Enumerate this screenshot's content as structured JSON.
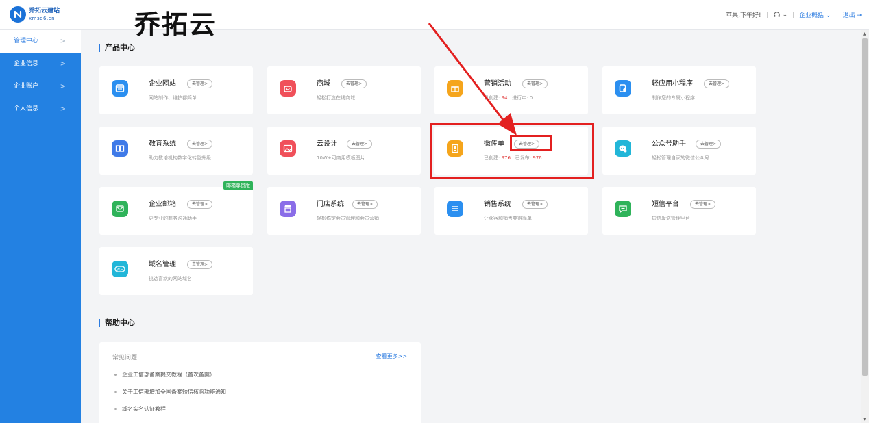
{
  "header": {
    "logo_name": "乔拓云建站",
    "logo_domain": "xmsq6.cn",
    "overlay_title": "乔拓云",
    "greeting": "苹果,下午好!",
    "enterprise_menu": "企业概括",
    "logout": "退出"
  },
  "sidebar": {
    "items": [
      {
        "label": "管理中心"
      },
      {
        "label": "企业信息"
      },
      {
        "label": "企业账户"
      },
      {
        "label": "个人信息"
      }
    ]
  },
  "product_center": {
    "title": "产品中心",
    "manage_label": "去管理>",
    "cards": [
      {
        "name": "企业网站",
        "desc": "网站制作、维护都简单",
        "icon": "website-icon",
        "color": "#2b8ff0"
      },
      {
        "name": "商城",
        "desc": "轻松打造在线商城",
        "icon": "shopping-bag-icon",
        "color": "#f0505a"
      },
      {
        "name": "营销活动",
        "desc_created_label": "已创建:",
        "desc_created_value": "94",
        "desc_active_label": "进行中:",
        "desc_active_value": "0",
        "icon": "gift-icon",
        "color": "#f5a51c"
      },
      {
        "name": "轻应用小程序",
        "desc": "制作您的专属小程序",
        "icon": "miniapp-icon",
        "color": "#2b8ff0"
      },
      {
        "name": "教育系统",
        "desc": "助力教培机构数字化转型升级",
        "icon": "book-icon",
        "color": "#3f7ae8"
      },
      {
        "name": "云设计",
        "desc": "10W+可商用模板图片",
        "icon": "image-icon",
        "color": "#f0505a"
      },
      {
        "name": "微传单",
        "desc_created_label": "已创建:",
        "desc_created_value": "976",
        "desc_published_label": "已发布:",
        "desc_published_value": "976",
        "icon": "flyer-icon",
        "color": "#f5a51c"
      },
      {
        "name": "公众号助手",
        "desc": "轻松管理自家的微信公众号",
        "icon": "wechat-icon",
        "color": "#22b6d8"
      },
      {
        "name": "企业邮箱",
        "desc": "更专业的商务沟通助手",
        "icon": "mail-icon",
        "color": "#2fb35a",
        "badge": "邮箱尊贵版"
      },
      {
        "name": "门店系统",
        "desc": "轻松搞定会员管理和会员营销",
        "icon": "store-icon",
        "color": "#8a6de8"
      },
      {
        "name": "销售系统",
        "desc": "让获客和销售变得简单",
        "icon": "list-icon",
        "color": "#2b8ff0"
      },
      {
        "name": "短信平台",
        "desc": "短信发送管理平台",
        "icon": "sms-icon",
        "color": "#2fb35a"
      },
      {
        "name": "域名管理",
        "desc": "挑选喜欢的网站域名",
        "icon": "domain-icon",
        "color": "#22b6d8"
      }
    ]
  },
  "help_center": {
    "title": "帮助中心",
    "faq_label": "常见问题:",
    "more_label": "查看更多>>",
    "items": [
      "企业工信部备案提交教程（首次备案）",
      "关于工信部增加全国备案短信核验功能通知",
      "域名实名认证教程"
    ]
  },
  "colors": {
    "sidebar": "#2381e2",
    "accent": "#2b7be0",
    "annotation": "#e32020"
  }
}
